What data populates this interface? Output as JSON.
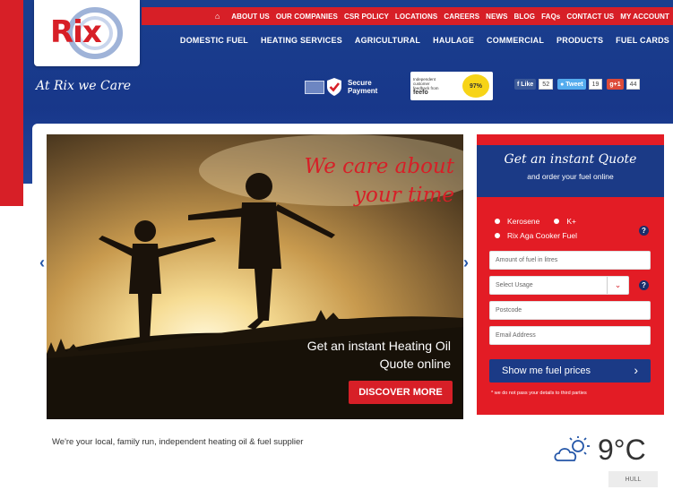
{
  "brand": {
    "logo_text": "Rix",
    "tagline": "At Rix we Care",
    "red": "#d71f27",
    "blue": "#1b3a86"
  },
  "topbar": {
    "home_icon": "home-icon",
    "links": [
      "ABOUT US",
      "OUR COMPANIES",
      "CSR POLICY",
      "LOCATIONS",
      "CAREERS",
      "NEWS",
      "BLOG",
      "FAQs",
      "CONTACT US",
      "MY ACCOUNT"
    ]
  },
  "mainnav": {
    "links": [
      "DOMESTIC FUEL",
      "HEATING SERVICES",
      "AGRICULTURAL",
      "HAULAGE",
      "COMMERCIAL",
      "PRODUCTS",
      "FUEL CARDS"
    ]
  },
  "badges": {
    "secure_line1": "Secure",
    "secure_line2": "Payment",
    "feefo_line1": "Independent",
    "feefo_line2": "customer",
    "feefo_line3": "feedback from",
    "feefo_brand": "feefo",
    "feefo_score": "97%"
  },
  "social": {
    "facebook_label": "Like",
    "facebook_count": "52",
    "twitter_label": "Tweet",
    "twitter_count": "19",
    "gplus_label": "g+1",
    "gplus_count": "44"
  },
  "hero": {
    "headline_line1": "We care about",
    "headline_line2": "your time",
    "sub_line1": "Get an instant Heating Oil",
    "sub_line2": "Quote online",
    "cta": "DISCOVER MORE",
    "prev_icon": "chevron-left-icon",
    "next_icon": "chevron-right-icon"
  },
  "quote": {
    "title": "Get an instant Quote",
    "subtitle": "and order your fuel online",
    "options": [
      "Kerosene",
      "K+",
      "Rix Aga Cooker Fuel"
    ],
    "amount_placeholder": "Amount of fuel in litres",
    "usage_placeholder": "Select Usage",
    "postcode_placeholder": "Postcode",
    "email_placeholder": "Email Address",
    "help": "?",
    "button": "Show me fuel prices",
    "disclaimer": "* we do not pass your details to third parties"
  },
  "intro": "We're your local, family run, independent heating oil & fuel supplier",
  "weather": {
    "icon": "partly-cloudy-icon",
    "temperature": "9°C",
    "city": "HULL"
  }
}
